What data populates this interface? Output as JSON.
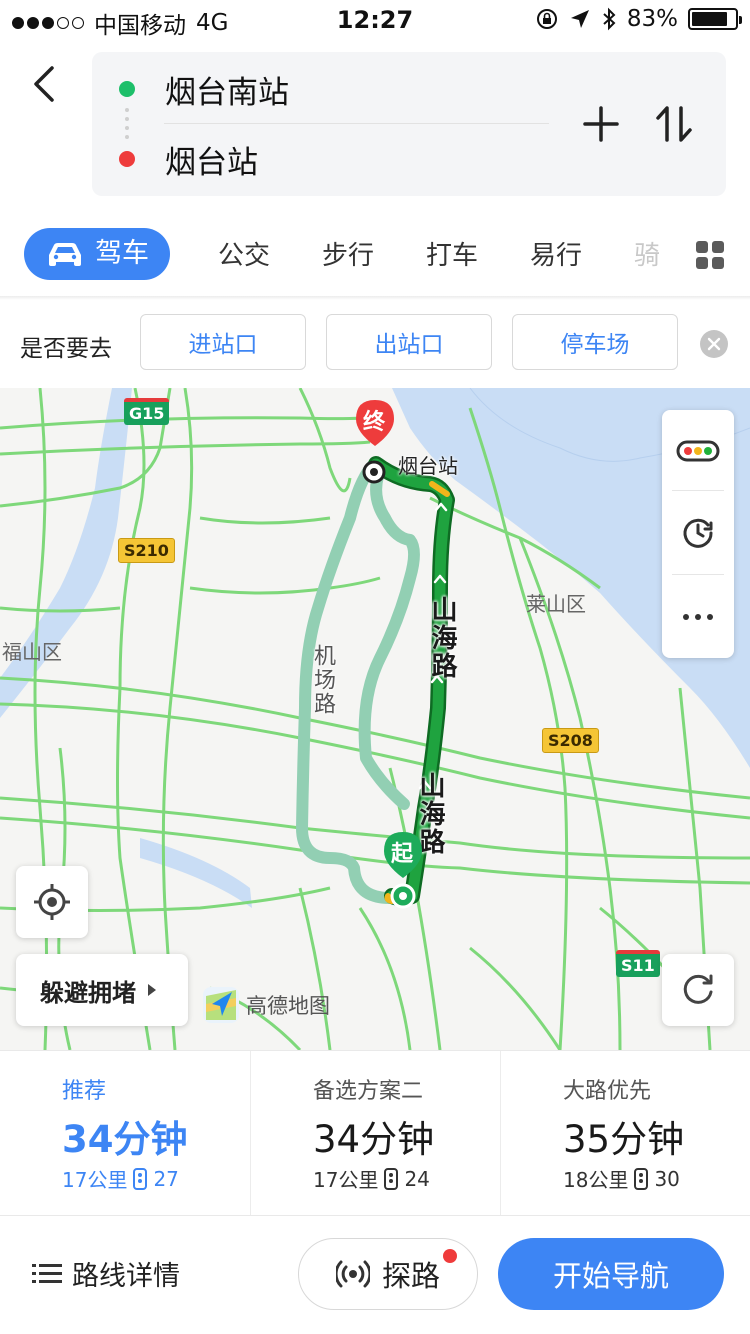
{
  "status_bar": {
    "carrier": "中国移动",
    "network": "4G",
    "time": "12:27",
    "battery_percent": "83%",
    "battery_level": 0.83
  },
  "route": {
    "origin": "烟台南站",
    "destination": "烟台站",
    "origin_color": "#1dbf6a",
    "destination_color": "#ee3c3c"
  },
  "modes": {
    "active": "驾车",
    "items": [
      "公交",
      "步行",
      "打车",
      "易行",
      "骑"
    ]
  },
  "destination_prompt": {
    "question": "是否要去",
    "options": [
      "进站口",
      "出站口",
      "停车场"
    ]
  },
  "map": {
    "district_labels": [
      "福山区",
      "莱山区"
    ],
    "shields": {
      "g15": "G15",
      "s210": "S210",
      "s208": "S208",
      "s11": "S11"
    },
    "station_label": "烟台站",
    "road_main": "山海路",
    "road_main_second": "山海路",
    "road_alt": "机场路",
    "end_pin": "终",
    "start_pin": "起",
    "avoid_congestion": "躲避拥堵",
    "logo_text": "高德地图",
    "route_color": "#1fa33f",
    "alt_route_color": "#92cfb3"
  },
  "route_options": [
    {
      "name": "推荐",
      "time": "34分钟",
      "distance": "17公里",
      "lights": "27"
    },
    {
      "name": "备选方案二",
      "time": "34分钟",
      "distance": "17公里",
      "lights": "24"
    },
    {
      "name": "大路优先",
      "time": "35分钟",
      "distance": "18公里",
      "lights": "30"
    }
  ],
  "bottom": {
    "details": "路线详情",
    "probe": "探路",
    "start_navigation": "开始导航"
  }
}
